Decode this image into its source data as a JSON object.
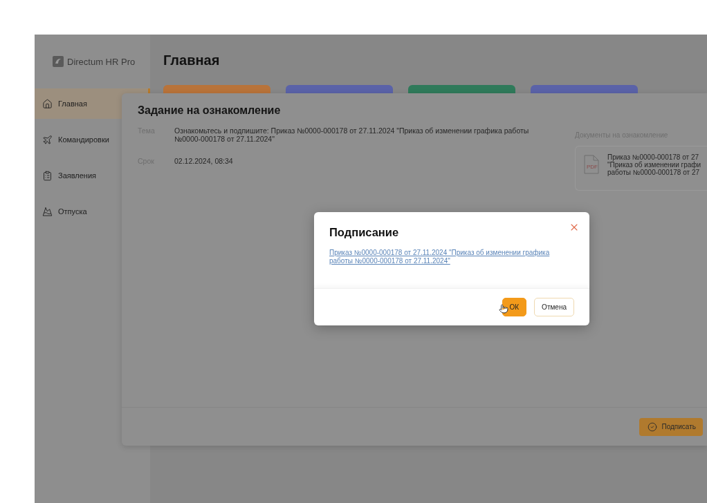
{
  "app": {
    "logo": "Directum HR Pro"
  },
  "sidebar": {
    "items": [
      {
        "label": "Главная",
        "kind": "home",
        "selected": true
      },
      {
        "label": "Командировки",
        "kind": "trip",
        "selected": false
      },
      {
        "label": "Заявления",
        "kind": "request",
        "selected": false
      },
      {
        "label": "Отпуска",
        "kind": "vacation",
        "selected": false
      }
    ]
  },
  "page": {
    "title": "Главная",
    "tiles": [
      {
        "color": "#b8733a"
      },
      {
        "color": "#5a62a8"
      },
      {
        "color": "#2f7a5a"
      },
      {
        "color": "#5a62a8"
      }
    ]
  },
  "task": {
    "title": "Задание на ознакомление",
    "fields": [
      {
        "label": "Тема",
        "value": "Ознакомьтесь и подпишите: Приказ №0000-000178 от 27.11.2024 \"Приказ об изменении графика работы №0000-000178 от 27.11.2024\""
      },
      {
        "label": "Срок",
        "value": "02.12.2024, 08:34"
      }
    ],
    "documents": {
      "heading": "Документы на ознакомление",
      "items": [
        {
          "file_type": "PDF",
          "lines": [
            "Приказ №0000-000178 от 27",
            "\"Приказ об изменении графи",
            "работы №0000-000178 от 27"
          ]
        }
      ]
    },
    "action": "Подписать"
  },
  "dialog": {
    "title": "Подписание",
    "link": "Приказ №0000-000178 от 27.11.2024 \"Приказ об изменении графика работы №0000-000178 от 27.11.2024\"",
    "buttons": [
      {
        "label": "ОК",
        "kind": "primary"
      },
      {
        "label": "Отмена",
        "kind": "secondary"
      }
    ]
  }
}
